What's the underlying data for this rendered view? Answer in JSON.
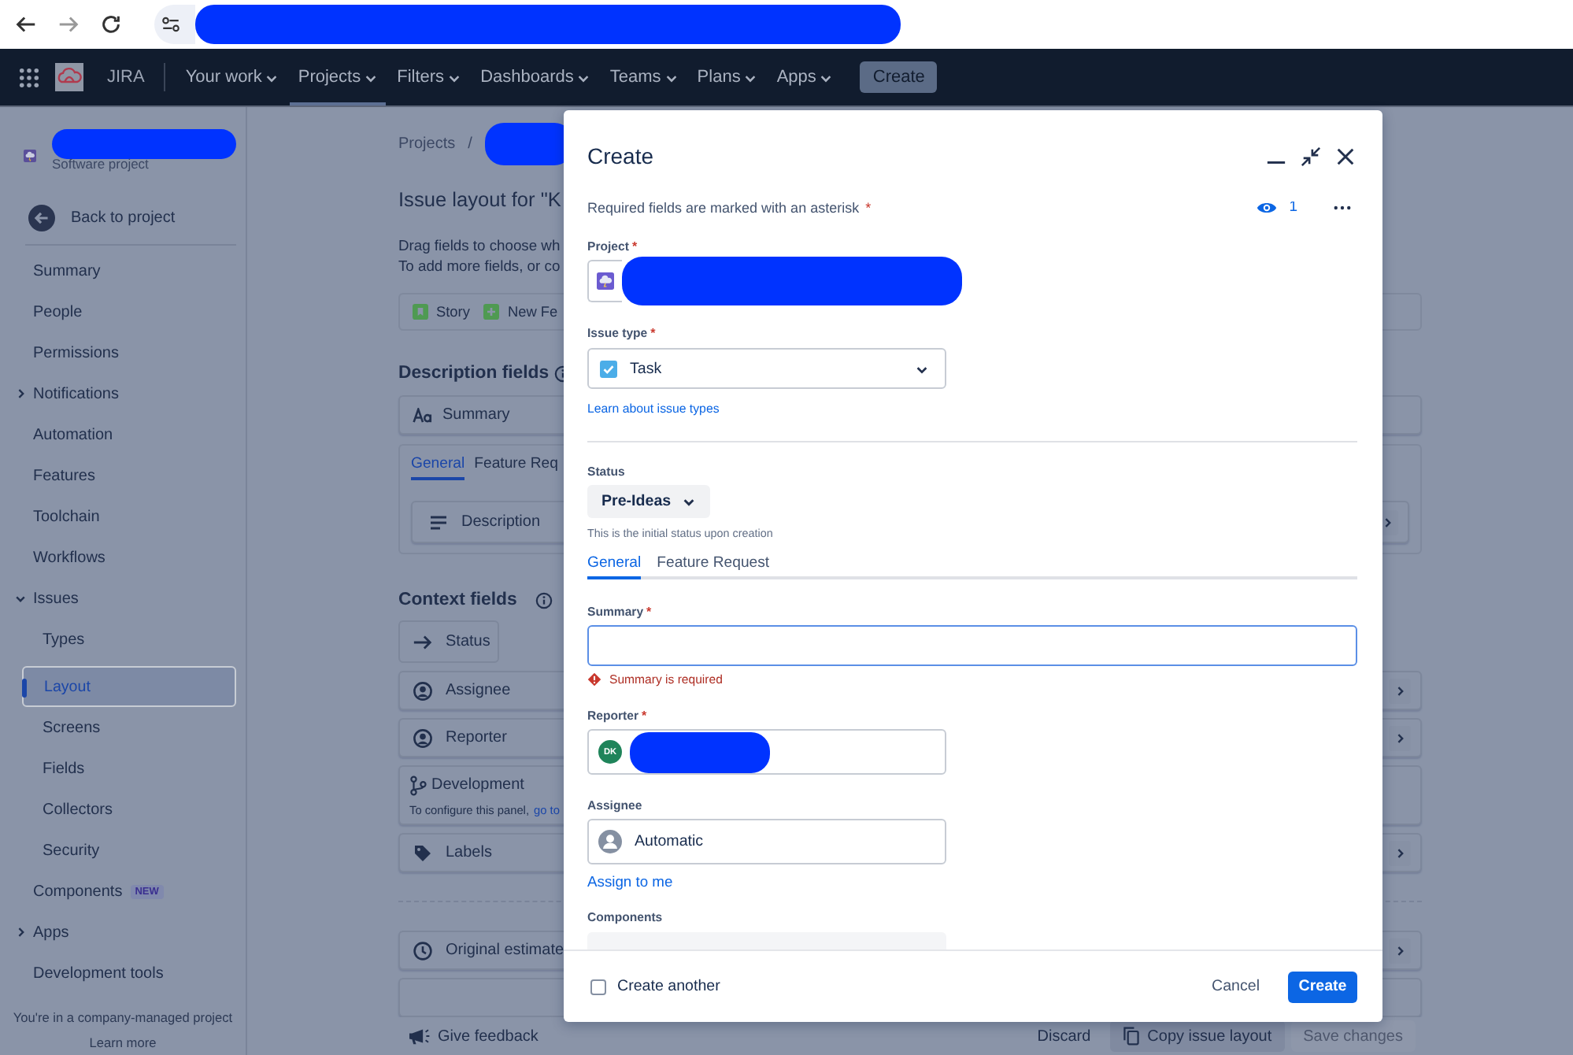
{
  "top_nav": {
    "product": "JIRA",
    "create_button": "Create",
    "items": [
      {
        "label": "Your work",
        "selected": false
      },
      {
        "label": "Projects",
        "selected": true
      },
      {
        "label": "Filters",
        "selected": false
      },
      {
        "label": "Dashboards",
        "selected": false
      },
      {
        "label": "Teams",
        "selected": false
      },
      {
        "label": "Plans",
        "selected": false
      },
      {
        "label": "Apps",
        "selected": false
      }
    ]
  },
  "sidebar": {
    "project_type": "Software project",
    "back_link": "Back to project",
    "items": [
      {
        "kind": "link",
        "label": "Summary",
        "selected": false
      },
      {
        "kind": "link",
        "label": "People",
        "selected": false
      },
      {
        "kind": "link",
        "label": "Permissions",
        "selected": false
      },
      {
        "kind": "group",
        "label": "Notifications",
        "selected": false,
        "expanded": false
      },
      {
        "kind": "link",
        "label": "Automation",
        "selected": false
      },
      {
        "kind": "link",
        "label": "Features",
        "selected": false
      },
      {
        "kind": "link",
        "label": "Toolchain",
        "selected": false
      },
      {
        "kind": "link",
        "label": "Workflows",
        "selected": false
      },
      {
        "kind": "group",
        "label": "Issues",
        "selected": false,
        "expanded": true,
        "children": [
          {
            "kind": "link",
            "label": "Types",
            "selected": false
          },
          {
            "kind": "link",
            "label": "Layout",
            "selected": true
          },
          {
            "kind": "link",
            "label": "Screens",
            "selected": false
          },
          {
            "kind": "link",
            "label": "Fields",
            "selected": false
          },
          {
            "kind": "link",
            "label": "Collectors",
            "selected": false
          },
          {
            "kind": "link",
            "label": "Security",
            "selected": false
          }
        ]
      },
      {
        "kind": "link",
        "label": "Components",
        "selected": false,
        "badge": "NEW"
      },
      {
        "kind": "group",
        "label": "Apps",
        "selected": false,
        "expanded": false
      },
      {
        "kind": "link",
        "label": "Development tools",
        "selected": false
      }
    ],
    "footer_note": "You're in a company-managed project",
    "footer_link": "Learn more"
  },
  "page": {
    "breadcrumb": "Projects",
    "separator": "/",
    "title": "Issue layout for \"K",
    "description_lines": [
      "Drag fields to choose wh",
      "To add more fields, or co"
    ],
    "issue_types": [
      {
        "kind": "story",
        "label": "Story"
      },
      {
        "kind": "feature",
        "label": "New Fe"
      }
    ],
    "description_section": {
      "heading": "Description fields",
      "fields": [
        {
          "kind": "text",
          "label": "Summary",
          "expandable": false
        }
      ],
      "tabs": [
        {
          "label": "General",
          "selected": true
        },
        {
          "label": "Feature Req",
          "selected": false
        }
      ],
      "tab_fields": [
        {
          "kind": "lines",
          "label": "Description",
          "expandable": true
        }
      ]
    },
    "context_section": {
      "heading": "Context fields",
      "fields": [
        {
          "kind": "move",
          "label": "Status",
          "expandable": false
        },
        {
          "kind": "person",
          "label": "Assignee",
          "expandable": true
        },
        {
          "kind": "person",
          "label": "Reporter",
          "expandable": true
        },
        {
          "kind": "branch",
          "label": "Development",
          "expandable": false,
          "note": "To configure this panel,",
          "note_link": "go to"
        },
        {
          "kind": "tag",
          "label": "Labels",
          "expandable": true
        }
      ]
    },
    "more_fields": [
      {
        "kind": "clock",
        "label": "Original estimate",
        "expandable": true
      }
    ],
    "feedback": "Give feedback",
    "actions": [
      {
        "kind": "plain",
        "label": "Discard",
        "disabled": false
      },
      {
        "kind": "copy",
        "label": "Copy issue layout",
        "disabled": false
      },
      {
        "kind": "plain",
        "label": "Save changes",
        "disabled": true
      }
    ]
  },
  "dialog": {
    "title": "Create",
    "required_note": "Required fields are marked with an asterisk",
    "required_mark": "*",
    "watchers": "1",
    "project": {
      "label": "Project",
      "mark": "*"
    },
    "issue_type": {
      "label": "Issue type",
      "mark": "*",
      "value": "Task"
    },
    "learn_link": "Learn about issue types",
    "status": {
      "label": "Status",
      "value": "Pre-Ideas",
      "help": "This is the initial status upon creation"
    },
    "tabs": [
      {
        "label": "General",
        "selected": true
      },
      {
        "label": "Feature Request",
        "selected": false
      }
    ],
    "summary": {
      "label": "Summary",
      "mark": "*",
      "error": "Summary is required"
    },
    "reporter": {
      "label": "Reporter",
      "mark": "*",
      "initials": "DK"
    },
    "assignee": {
      "label": "Assignee",
      "value": "Automatic",
      "assign_link": "Assign to me"
    },
    "components": {
      "label": "Components"
    },
    "create_another": {
      "label": "Create another",
      "checked": false
    },
    "cancel": "Cancel",
    "submit": "Create"
  }
}
